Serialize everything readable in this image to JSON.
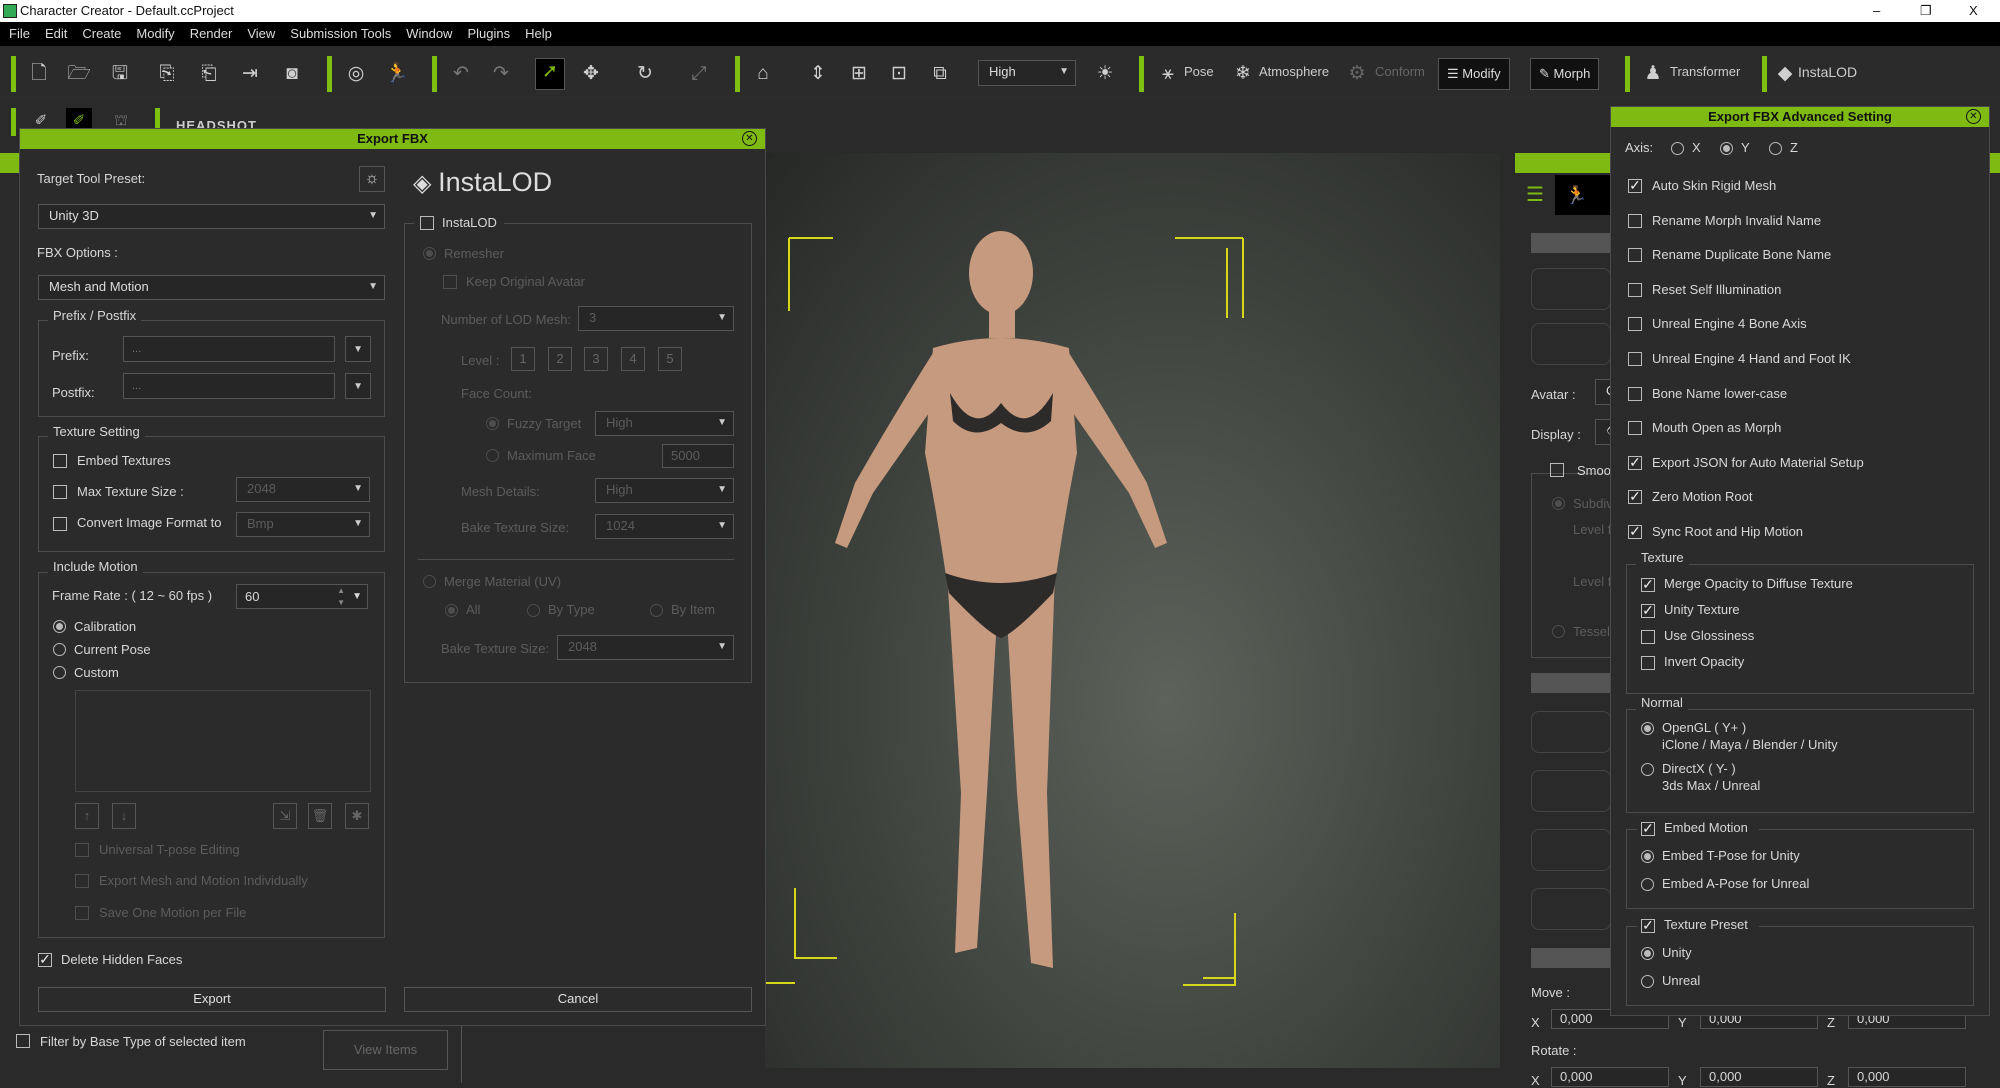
{
  "window": {
    "title": "Character Creator - Default.ccProject",
    "controls": [
      "–",
      "❐",
      "X"
    ]
  },
  "menu": [
    "File",
    "Edit",
    "Create",
    "Modify",
    "Render",
    "View",
    "Submission Tools",
    "Window",
    "Plugins",
    "Help"
  ],
  "toolbar": {
    "quality": "High",
    "pose": "Pose",
    "atmosphere": "Atmosphere",
    "conform": "Conform",
    "modify": "Modify",
    "morph": "Morph",
    "transformer": "Transformer",
    "instalod": "InstaLOD",
    "headshot": "HEADSHOT"
  },
  "accent": "#7fba13",
  "export_fbx": {
    "title": "Export FBX",
    "target_label": "Target Tool Preset:",
    "target_value": "Unity 3D",
    "fbx_options_label": "FBX Options :",
    "fbx_options_value": "Mesh and Motion",
    "prefix_group": "Prefix / Postfix",
    "prefix_label": "Prefix:",
    "prefix_placeholder": "...",
    "postfix_label": "Postfix:",
    "postfix_placeholder": "...",
    "texture_group": "Texture Setting",
    "embed_textures": "Embed Textures",
    "max_texture": "Max Texture Size :",
    "max_texture_value": "2048",
    "convert_format": "Convert Image Format to",
    "convert_value": "Bmp",
    "motion_group": "Include Motion",
    "frame_rate_label": "Frame Rate : ( 12 ~ 60 fps )",
    "frame_rate": "60",
    "calibration": "Calibration",
    "current_pose": "Current Pose",
    "custom": "Custom",
    "universal_tpose": "Universal T-pose Editing",
    "export_individually": "Export Mesh and Motion Individually",
    "one_motion": "Save One Motion per File",
    "delete_hidden": "Delete Hidden Faces",
    "export": "Export",
    "cancel": "Cancel",
    "instalod": {
      "logo": "InstaLOD",
      "enable": "InstaLOD",
      "remesher": "Remesher",
      "keep_original": "Keep Original Avatar",
      "lod_count_label": "Number of LOD Mesh:",
      "lod_count": "3",
      "level_label": "Level :",
      "levels": [
        "1",
        "2",
        "3",
        "4",
        "5"
      ],
      "face_count": "Face Count:",
      "fuzzy": "Fuzzy Target",
      "fuzzy_value": "High",
      "max_face": "Maximum Face",
      "max_face_value": "5000",
      "mesh_details": "Mesh Details:",
      "mesh_details_value": "High",
      "bake_label": "Bake Texture Size:",
      "bake_value": "1024",
      "merge": "Merge Material (UV)",
      "all": "All",
      "by_type": "By Type",
      "by_item": "By Item",
      "merge_bake_label": "Bake Texture Size:",
      "merge_bake_value": "2048"
    }
  },
  "below": {
    "filter": "Filter by Base Type of selected item",
    "view_items": "View Items"
  },
  "side": {
    "avatar": "Avatar :",
    "avatar_value": "Cı",
    "display": "Display :",
    "smooth": "Smoot",
    "subdiv": "Subdiv",
    "level1": "Level f",
    "level2": "Level f",
    "tessel": "Tessel",
    "move": "Move :",
    "rotate": "Rotate :",
    "x": "X",
    "y": "Y",
    "z": "Z",
    "zero": "0,000"
  },
  "advanced": {
    "title": "Export FBX Advanced Setting",
    "axis_label": "Axis:",
    "axis": [
      "X",
      "Y",
      "Z"
    ],
    "axis_selected": "Y",
    "options": [
      {
        "label": "Auto Skin Rigid Mesh",
        "checked": true
      },
      {
        "label": "Rename Morph Invalid Name",
        "checked": false
      },
      {
        "label": "Rename Duplicate Bone Name",
        "checked": false
      },
      {
        "label": "Reset Self Illumination",
        "checked": false
      },
      {
        "label": "Unreal Engine 4 Bone Axis",
        "checked": false
      },
      {
        "label": "Unreal Engine 4 Hand and Foot IK",
        "checked": false
      },
      {
        "label": "Bone Name lower-case",
        "checked": false
      },
      {
        "label": "Mouth Open as Morph",
        "checked": false
      },
      {
        "label": "Export JSON for Auto Material Setup",
        "checked": true
      },
      {
        "label": "Zero Motion Root",
        "checked": true
      },
      {
        "label": "Sync Root and Hip Motion",
        "checked": true
      }
    ],
    "texture_group": "Texture",
    "texture": [
      {
        "label": "Merge Opacity to Diffuse Texture",
        "checked": true
      },
      {
        "label": "Unity Texture",
        "checked": true
      },
      {
        "label": "Use Glossiness",
        "checked": false
      },
      {
        "label": "Invert Opacity",
        "checked": false
      }
    ],
    "normal_group": "Normal",
    "opengl": "OpenGL ( Y+ )",
    "opengl_sub": "iClone / Maya / Blender / Unity",
    "directx": "DirectX ( Y- )",
    "directx_sub": "3ds Max / Unreal",
    "embed_motion": "Embed Motion",
    "tpose": "Embed T-Pose for Unity",
    "apose": "Embed A-Pose for Unreal",
    "texture_preset": "Texture Preset",
    "unity": "Unity",
    "unreal": "Unreal"
  }
}
